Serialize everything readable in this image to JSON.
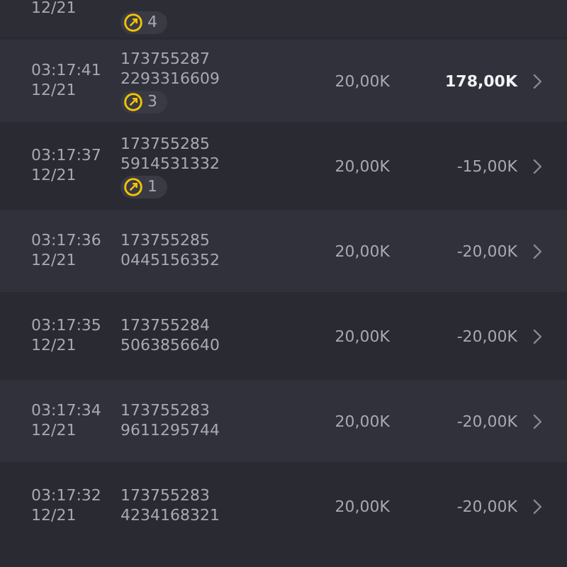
{
  "partial_row": {
    "date": "12/21",
    "badge": "4"
  },
  "rows": [
    {
      "time": "03:17:41",
      "date": "12/21",
      "id_line_1": "173755287",
      "id_line_2": "2293316609",
      "badge": "3",
      "bet": "20,00K",
      "result": "178,00K",
      "win": true
    },
    {
      "time": "03:17:37",
      "date": "12/21",
      "id_line_1": "173755285",
      "id_line_2": "5914531332",
      "badge": "1",
      "bet": "20,00K",
      "result": "-15,00K",
      "win": false
    },
    {
      "time": "03:17:36",
      "date": "12/21",
      "id_line_1": "173755285",
      "id_line_2": "0445156352",
      "bet": "20,00K",
      "result": "-20,00K",
      "win": false
    },
    {
      "time": "03:17:35",
      "date": "12/21",
      "id_line_1": "173755284",
      "id_line_2": "5063856640",
      "bet": "20,00K",
      "result": "-20,00K",
      "win": false
    },
    {
      "time": "03:17:34",
      "date": "12/21",
      "id_line_1": "173755283",
      "id_line_2": "9611295744",
      "bet": "20,00K",
      "result": "-20,00K",
      "win": false
    },
    {
      "time": "03:17:32",
      "date": "12/21",
      "id_line_1": "173755283",
      "id_line_2": "4234168321",
      "bet": "20,00K",
      "result": "-20,00K",
      "win": false
    }
  ]
}
